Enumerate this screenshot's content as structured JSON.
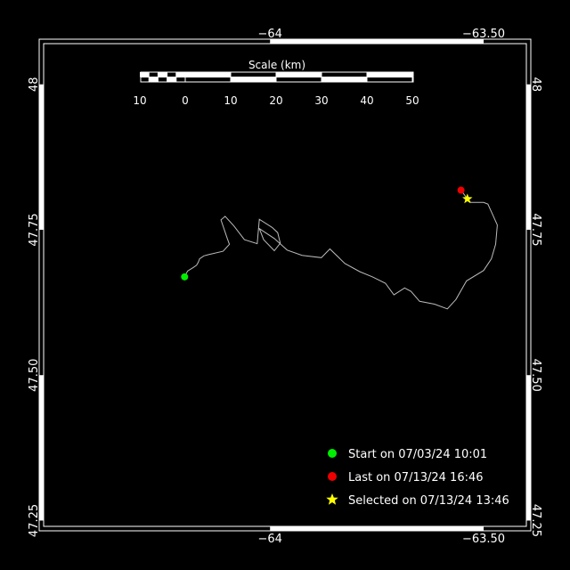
{
  "map": {
    "lon_ticks": [
      {
        "value": -64,
        "label": "−64"
      },
      {
        "value": -63.5,
        "label": "−63.50"
      }
    ],
    "lat_ticks": [
      {
        "value": 48,
        "label": "48"
      },
      {
        "value": 47.75,
        "label": "47.75"
      },
      {
        "value": 47.5,
        "label": "47.50"
      },
      {
        "value": 47.25,
        "label": "47.25"
      }
    ],
    "lon_range": [
      -64.53,
      -63.4
    ],
    "lat_range": [
      47.24,
      48.07
    ]
  },
  "scale": {
    "title": "Scale (km)",
    "labels": [
      "10",
      "0",
      "10",
      "20",
      "30",
      "40",
      "50"
    ]
  },
  "legend": {
    "start": {
      "label": "Start on 07/03/24 10:01",
      "color": "#00ee00"
    },
    "last": {
      "label": "Last on 07/13/24 16:46",
      "color": "#ee0000"
    },
    "selected": {
      "label": "Selected on 07/13/24 13:46",
      "color": "#ffff00"
    }
  },
  "track": {
    "color": "#bbbbbb",
    "points": [
      [
        -64.2,
        47.669
      ],
      [
        -64.193,
        47.679
      ],
      [
        -64.18,
        47.685
      ],
      [
        -64.172,
        47.689
      ],
      [
        -64.168,
        47.694
      ],
      [
        -64.165,
        47.7
      ],
      [
        -64.155,
        47.705
      ],
      [
        -64.145,
        47.707
      ],
      [
        -64.11,
        47.713
      ],
      [
        -64.095,
        47.725
      ],
      [
        -64.1,
        47.735
      ],
      [
        -64.115,
        47.767
      ],
      [
        -64.105,
        47.773
      ],
      [
        -64.085,
        47.757
      ],
      [
        -64.06,
        47.733
      ],
      [
        -64.03,
        47.726
      ],
      [
        -64.025,
        47.768
      ],
      [
        -63.995,
        47.754
      ],
      [
        -63.982,
        47.745
      ],
      [
        -63.976,
        47.727
      ],
      [
        -63.99,
        47.714
      ],
      [
        -64.015,
        47.733
      ],
      [
        -64.025,
        47.752
      ],
      [
        -63.99,
        47.735
      ],
      [
        -63.975,
        47.725
      ],
      [
        -63.96,
        47.715
      ],
      [
        -63.925,
        47.706
      ],
      [
        -63.88,
        47.702
      ],
      [
        -63.86,
        47.717
      ],
      [
        -63.825,
        47.692
      ],
      [
        -63.79,
        47.678
      ],
      [
        -63.76,
        47.669
      ],
      [
        -63.73,
        47.658
      ],
      [
        -63.71,
        47.638
      ],
      [
        -63.685,
        47.65
      ],
      [
        -63.67,
        47.644
      ],
      [
        -63.65,
        47.627
      ],
      [
        -63.615,
        47.622
      ],
      [
        -63.585,
        47.614
      ],
      [
        -63.565,
        47.63
      ],
      [
        -63.54,
        47.662
      ],
      [
        -63.5,
        47.68
      ],
      [
        -63.482,
        47.7
      ],
      [
        -63.472,
        47.725
      ],
      [
        -63.468,
        47.758
      ],
      [
        -63.48,
        47.778
      ],
      [
        -63.49,
        47.794
      ],
      [
        -63.5,
        47.797
      ],
      [
        -63.53,
        47.797
      ],
      [
        -63.538,
        47.803
      ],
      [
        -63.545,
        47.81
      ],
      [
        -63.553,
        47.818
      ]
    ],
    "start_point": [
      -64.2,
      47.669
    ],
    "last_point": [
      -63.553,
      47.818
    ],
    "selected_point": [
      -63.538,
      47.803
    ]
  }
}
